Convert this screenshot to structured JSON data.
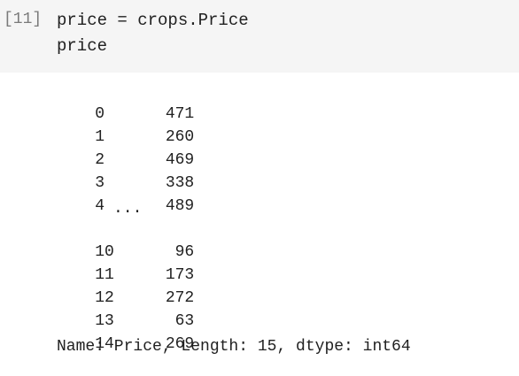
{
  "cell": {
    "execution_count": "[11]",
    "code_lines": [
      "price = crops.Price",
      "price"
    ]
  },
  "output": {
    "head_rows": [
      {
        "index": "0",
        "value": "471"
      },
      {
        "index": "1",
        "value": "260"
      },
      {
        "index": "2",
        "value": "469"
      },
      {
        "index": "3",
        "value": "338"
      },
      {
        "index": "4",
        "value": "489"
      }
    ],
    "ellipsis": "...",
    "tail_rows": [
      {
        "index": "10",
        "value": "96"
      },
      {
        "index": "11",
        "value": "173"
      },
      {
        "index": "12",
        "value": "272"
      },
      {
        "index": "13",
        "value": "63"
      },
      {
        "index": "14",
        "value": "269"
      }
    ],
    "footer": "Name: Price, Length: 15, dtype: int64"
  }
}
